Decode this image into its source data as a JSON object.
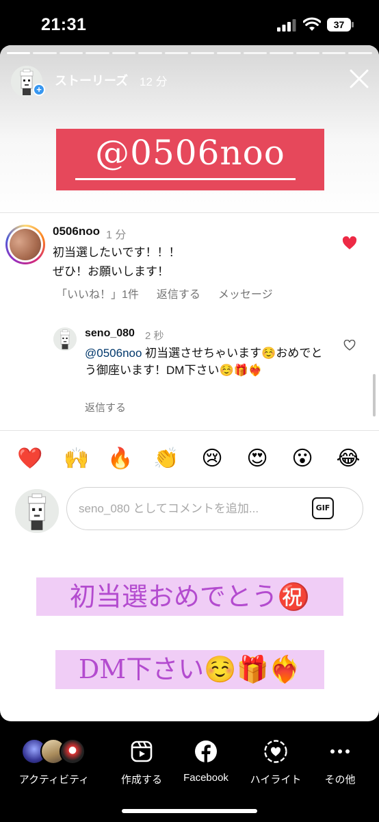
{
  "status_bar": {
    "time": "21:31",
    "battery": "37"
  },
  "story": {
    "progress_segments": 14,
    "progress_done": 1,
    "user": "ストーリーズ",
    "time": "12 分",
    "banner": "@0506noo"
  },
  "comment": {
    "user": "0506noo",
    "time": "1 分",
    "line1": "初当選したいです！！！",
    "line2": "ぜひ！お願いします！",
    "likes": "「いいね！」1件",
    "reply": "返信する",
    "message": "メッセージ"
  },
  "reply": {
    "user": "seno_080",
    "time": "2 秒",
    "mention": "@0506noo",
    "text": " 初当選させちゃいます☺️おめでとう御座います！DM下さい☺️🎁❤️‍🔥",
    "action": "返信する"
  },
  "emojis": [
    "❤️",
    "🙌",
    "🔥",
    "👏",
    "😢",
    "😍",
    "😮",
    "😂"
  ],
  "composer": {
    "placeholder": "seno_080 としてコメントを追加...",
    "gif_label": "GIF"
  },
  "stickers": {
    "line1": "初当選おめでとう㊗️",
    "line2": "DM下さい☺️🎁❤️‍🔥"
  },
  "toolbar": {
    "activity": "アクティビティ",
    "create": "作成する",
    "facebook": "Facebook",
    "highlight": "ハイライト",
    "more": "その他"
  }
}
